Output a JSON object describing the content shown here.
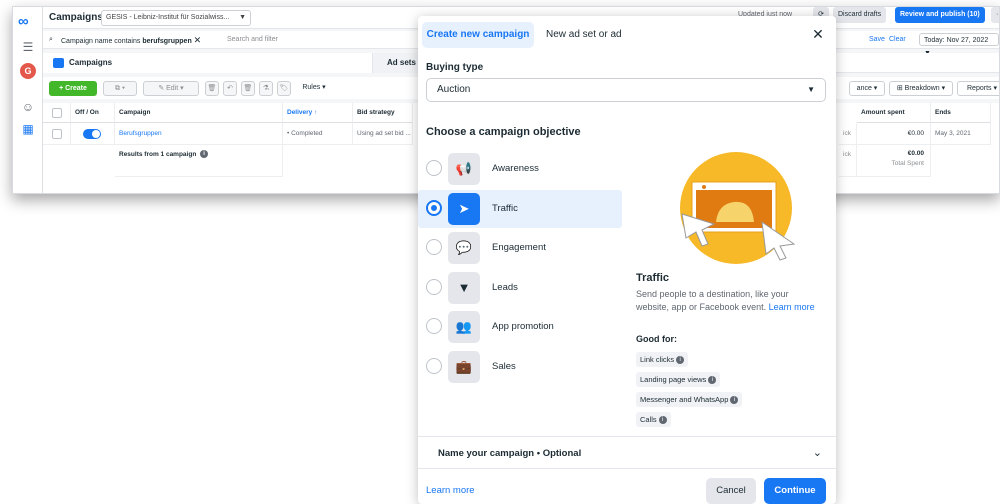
{
  "colors": {
    "accent": "#1877f2",
    "create_green": "#42b72a",
    "selected_bg": "#e7f1fe",
    "illustration": "#f7b928"
  },
  "bg": {
    "title": "Campaigns",
    "account": "GESIS - Leibniz-Institut für Sozialwiss...",
    "updated": "Updated just now",
    "discard": "Discard drafts",
    "review": "Review and publish (10)",
    "save": "Save",
    "clear": "Clear",
    "date": "Today: Nov 27, 2022",
    "filter_prefix": "Campaign name contains ",
    "filter_value": "berufsgruppen",
    "search_placeholder": "Search and filter",
    "tab_campaigns": "Campaigns",
    "tab_adsets": "Ad sets",
    "create": "+ Create",
    "edit": "Edit",
    "rules": "Rules",
    "columns_label": "ance",
    "breakdown": "Breakdown",
    "reports": "Reports",
    "headers": {
      "onoff": "Off / On",
      "campaign": "Campaign",
      "delivery": "Delivery ↑",
      "bid": "Bid strategy",
      "amount": "Amount spent",
      "ends": "Ends"
    },
    "row": {
      "name": "Berufsgruppen",
      "delivery": "Completed",
      "bid": "Using ad set bid ...",
      "amount": "€0.00",
      "ends": "May 3, 2021",
      "amount_total": "€0.00",
      "total_label": "Total Spent",
      "ick1": "ick",
      "ick2": "ick"
    },
    "results": "Results from 1 campaign"
  },
  "modal": {
    "tab_create": "Create new campaign",
    "tab_new": "New ad set or ad",
    "buying_type_label": "Buying type",
    "buying_type_value": "Auction",
    "objective_label": "Choose a campaign objective",
    "objectives": [
      {
        "label": "Awareness",
        "icon": "megaphone-icon",
        "glyph": "📢"
      },
      {
        "label": "Traffic",
        "icon": "cursor-icon",
        "glyph": "➤"
      },
      {
        "label": "Engagement",
        "icon": "chat-bubbles-icon",
        "glyph": "💬"
      },
      {
        "label": "Leads",
        "icon": "funnel-icon",
        "glyph": "▼"
      },
      {
        "label": "App promotion",
        "icon": "people-icon",
        "glyph": "👥"
      },
      {
        "label": "Sales",
        "icon": "briefcase-icon",
        "glyph": "💼"
      }
    ],
    "selected_objective": "Traffic",
    "detail_title": "Traffic",
    "detail_desc": "Send people to a destination, like your website, app or Facebook event.",
    "detail_learn": "Learn more",
    "good_for": "Good for:",
    "good_for_items": [
      "Link clicks",
      "Landing page views",
      "Messenger and WhatsApp",
      "Calls"
    ],
    "name_campaign": "Name your campaign • Optional",
    "learn_more": "Learn more",
    "cancel": "Cancel",
    "continue": "Continue"
  }
}
